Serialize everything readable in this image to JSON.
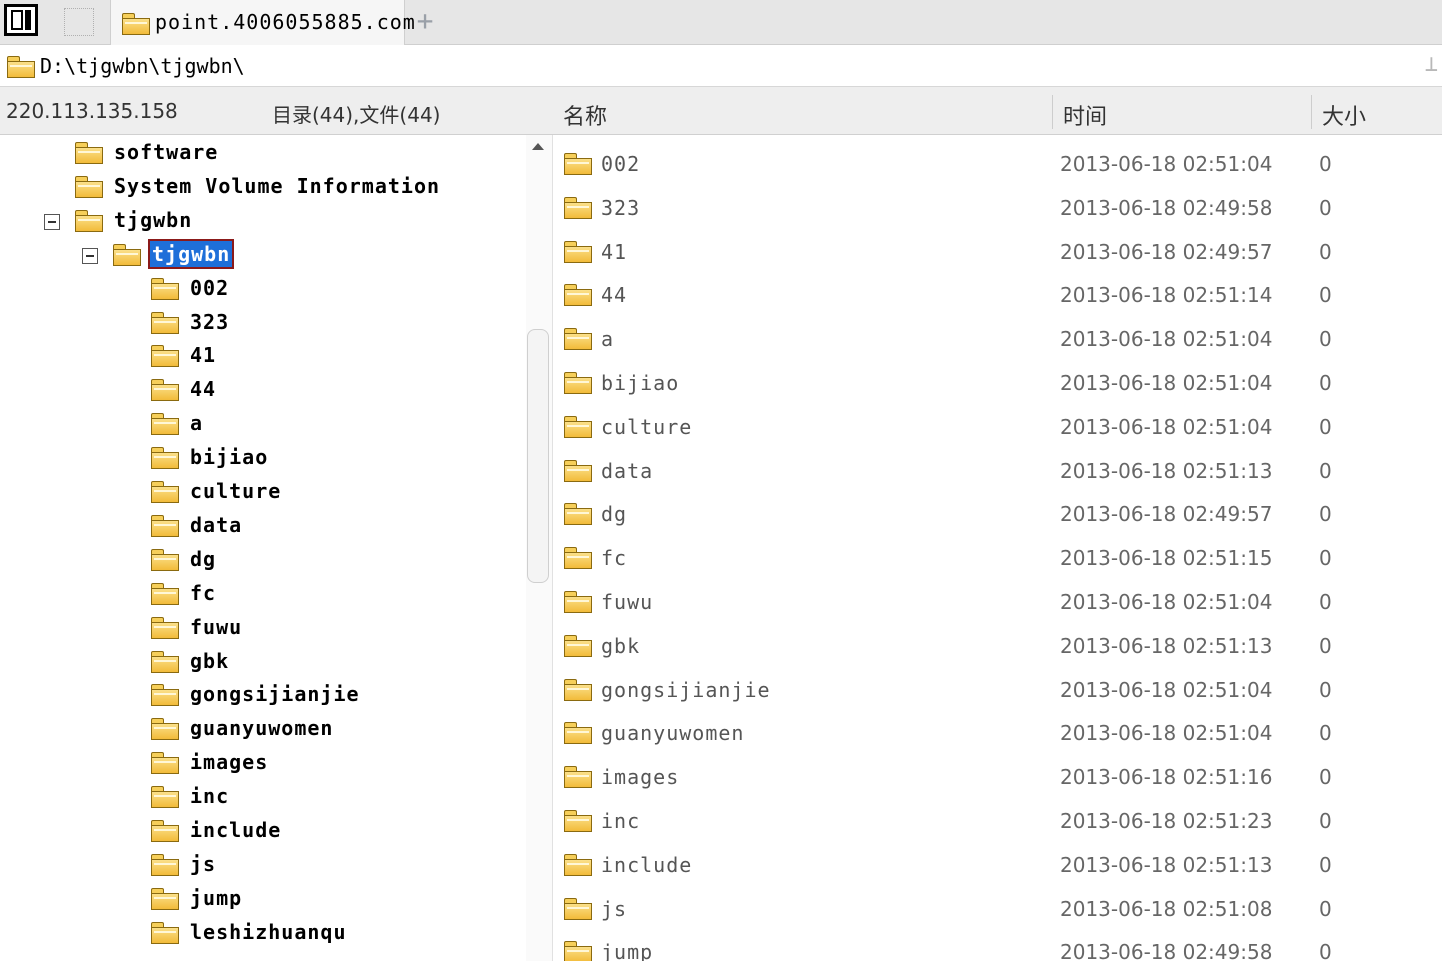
{
  "tabbar": {
    "active_tab_label": "point.4006055885.com",
    "add_tab_symbol": "+"
  },
  "pathbar": {
    "path": "D:\\tjgwbn\\tjgwbn\\",
    "pin_symbol": "⊥"
  },
  "left_header": {
    "server_ip": "220.113.135.158",
    "summary": "目录(44),文件(44)"
  },
  "tree": {
    "items": [
      {
        "label": "software",
        "level": 0,
        "expander": false,
        "selected": false
      },
      {
        "label": "System Volume Information",
        "level": 0,
        "expander": false,
        "selected": false
      },
      {
        "label": "tjgwbn",
        "level": 0,
        "expander": true,
        "selected": false
      },
      {
        "label": "tjgwbn",
        "level": 1,
        "expander": true,
        "selected": true
      },
      {
        "label": "002",
        "level": 2,
        "expander": false,
        "selected": false
      },
      {
        "label": "323",
        "level": 2,
        "expander": false,
        "selected": false
      },
      {
        "label": "41",
        "level": 2,
        "expander": false,
        "selected": false
      },
      {
        "label": "44",
        "level": 2,
        "expander": false,
        "selected": false
      },
      {
        "label": "a",
        "level": 2,
        "expander": false,
        "selected": false
      },
      {
        "label": "bijiao",
        "level": 2,
        "expander": false,
        "selected": false
      },
      {
        "label": "culture",
        "level": 2,
        "expander": false,
        "selected": false
      },
      {
        "label": "data",
        "level": 2,
        "expander": false,
        "selected": false
      },
      {
        "label": "dg",
        "level": 2,
        "expander": false,
        "selected": false
      },
      {
        "label": "fc",
        "level": 2,
        "expander": false,
        "selected": false
      },
      {
        "label": "fuwu",
        "level": 2,
        "expander": false,
        "selected": false
      },
      {
        "label": "gbk",
        "level": 2,
        "expander": false,
        "selected": false
      },
      {
        "label": "gongsijianjie",
        "level": 2,
        "expander": false,
        "selected": false
      },
      {
        "label": "guanyuwomen",
        "level": 2,
        "expander": false,
        "selected": false
      },
      {
        "label": "images",
        "level": 2,
        "expander": false,
        "selected": false
      },
      {
        "label": "inc",
        "level": 2,
        "expander": false,
        "selected": false
      },
      {
        "label": "include",
        "level": 2,
        "expander": false,
        "selected": false
      },
      {
        "label": "js",
        "level": 2,
        "expander": false,
        "selected": false
      },
      {
        "label": "jump",
        "level": 2,
        "expander": false,
        "selected": false
      },
      {
        "label": "leshizhuanqu",
        "level": 2,
        "expander": false,
        "selected": false
      }
    ]
  },
  "list": {
    "columns": {
      "name": "名称",
      "time": "时间",
      "size": "大小"
    },
    "rows": [
      {
        "name": "002",
        "time": "2013-06-18 02:51:04",
        "size": "0"
      },
      {
        "name": "323",
        "time": "2013-06-18 02:49:58",
        "size": "0"
      },
      {
        "name": "41",
        "time": "2013-06-18 02:49:57",
        "size": "0"
      },
      {
        "name": "44",
        "time": "2013-06-18 02:51:14",
        "size": "0"
      },
      {
        "name": "a",
        "time": "2013-06-18 02:51:04",
        "size": "0"
      },
      {
        "name": "bijiao",
        "time": "2013-06-18 02:51:04",
        "size": "0"
      },
      {
        "name": "culture",
        "time": "2013-06-18 02:51:04",
        "size": "0"
      },
      {
        "name": "data",
        "time": "2013-06-18 02:51:13",
        "size": "0"
      },
      {
        "name": "dg",
        "time": "2013-06-18 02:49:57",
        "size": "0"
      },
      {
        "name": "fc",
        "time": "2013-06-18 02:51:15",
        "size": "0"
      },
      {
        "name": "fuwu",
        "time": "2013-06-18 02:51:04",
        "size": "0"
      },
      {
        "name": "gbk",
        "time": "2013-06-18 02:51:13",
        "size": "0"
      },
      {
        "name": "gongsijianjie",
        "time": "2013-06-18 02:51:04",
        "size": "0"
      },
      {
        "name": "guanyuwomen",
        "time": "2013-06-18 02:51:04",
        "size": "0"
      },
      {
        "name": "images",
        "time": "2013-06-18 02:51:16",
        "size": "0"
      },
      {
        "name": "inc",
        "time": "2013-06-18 02:51:23",
        "size": "0"
      },
      {
        "name": "include",
        "time": "2013-06-18 02:51:13",
        "size": "0"
      },
      {
        "name": "js",
        "time": "2013-06-18 02:51:08",
        "size": "0"
      },
      {
        "name": "jump",
        "time": "2013-06-18 02:49:58",
        "size": "0"
      }
    ]
  },
  "icons": {
    "folder": "folder-icon",
    "panel_toggle": "panel-toggle-icon",
    "collapse": "collapse-icon"
  },
  "colors": {
    "selection": "#1e6fd9",
    "folder_fill": "#f2bb3a"
  }
}
